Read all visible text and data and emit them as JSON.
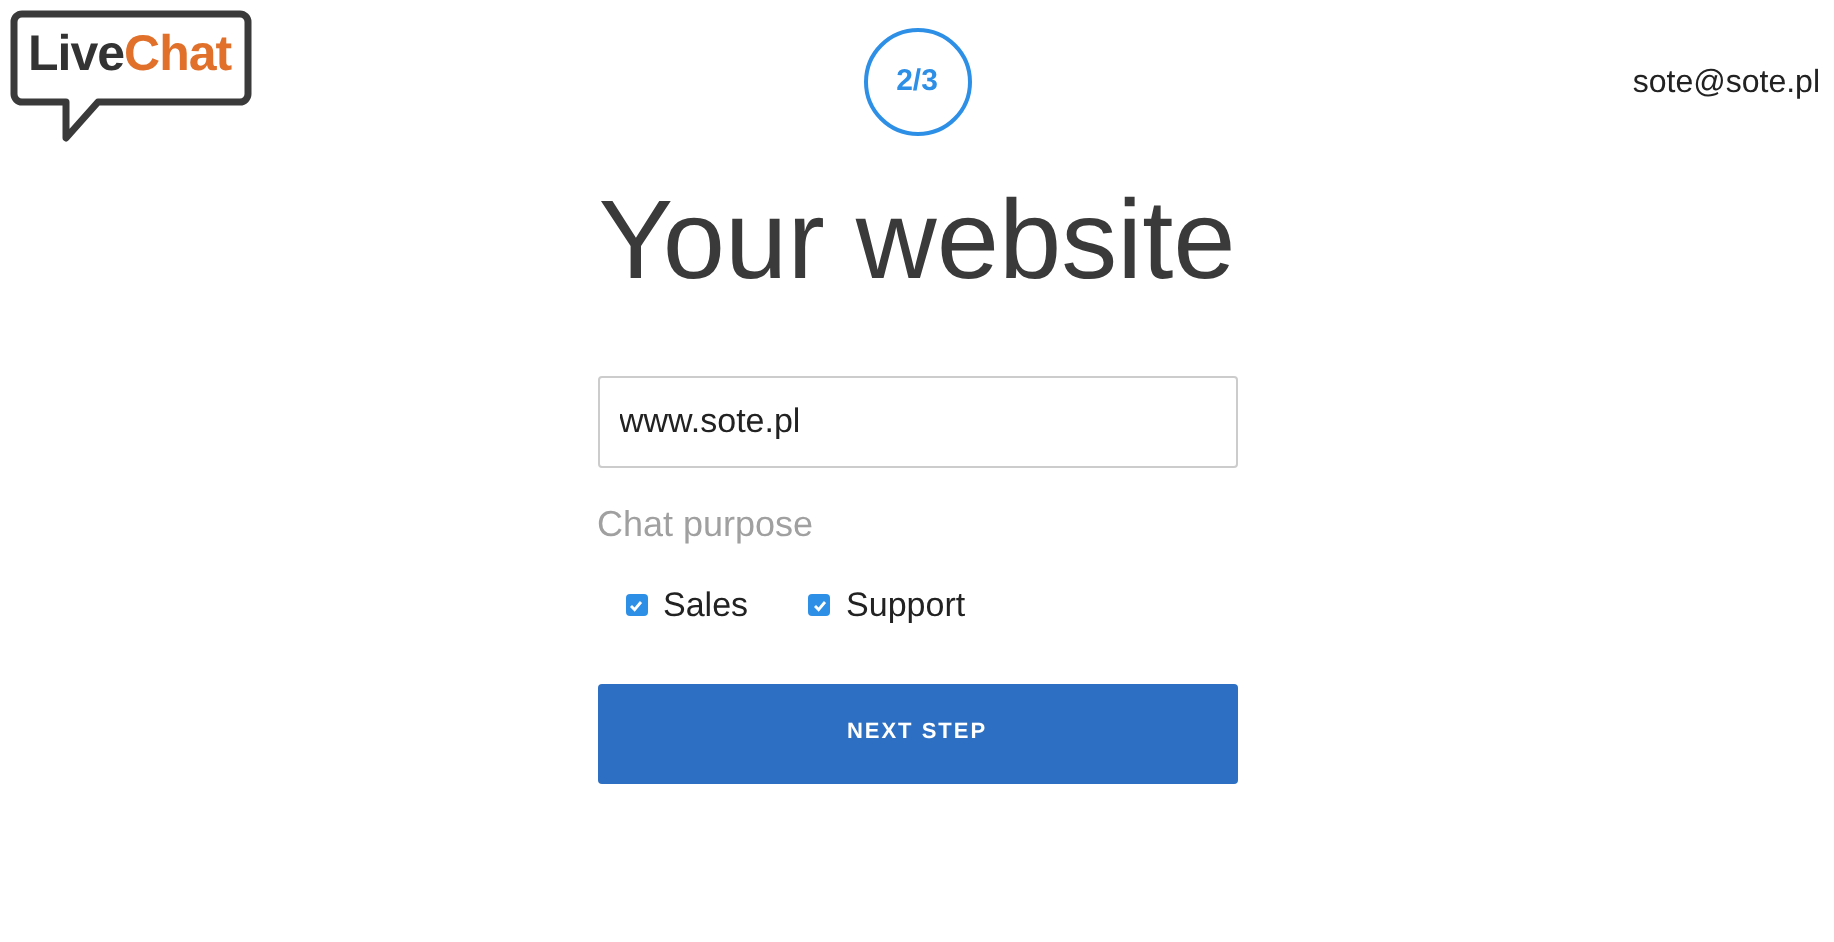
{
  "logo": {
    "part_1": "Live",
    "part_2": "Chat"
  },
  "user_email": "sote@sote.pl",
  "step": "2/3",
  "title": "Your website",
  "website_field": {
    "value": "www.sote.pl"
  },
  "purpose_label": "Chat purpose",
  "purposes": [
    {
      "label": "Sales",
      "checked": true
    },
    {
      "label": "Support",
      "checked": true
    }
  ],
  "next_button": "NEXT STEP"
}
